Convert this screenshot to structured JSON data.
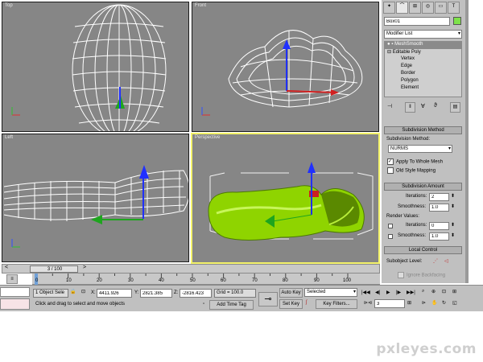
{
  "viewports": {
    "top": "Top",
    "front": "Front",
    "left": "Left",
    "perspective": "Perspective"
  },
  "command_panel": {
    "object_name": "Box01",
    "modifier_list": "Modifier List",
    "stack": [
      "MeshSmooth",
      "Editable Poly",
      "Vertex",
      "Edge",
      "Border",
      "Polygon",
      "Element"
    ],
    "subdivision_method": {
      "title": "Subdivision Method",
      "label": "Subdivision Method:",
      "value": "NURMS",
      "apply_whole_mesh": "Apply To Whole Mesh",
      "old_style": "Old Style Mapping"
    },
    "subdivision_amount": {
      "title": "Subdivision Amount",
      "iterations_label": "Iterations:",
      "iterations_value": "2",
      "smoothness_label": "Smoothness:",
      "smoothness_value": "1.0",
      "render_values": "Render Values:",
      "r_iterations_label": "Iterations:",
      "r_iterations_value": "0",
      "r_smoothness_label": "Smoothness:",
      "r_smoothness_value": "1.0"
    },
    "local_control": {
      "title": "Local Control",
      "subobject_level": "Subobject Level:",
      "ignore_backfacing": "Ignore Backfacing"
    }
  },
  "timeline": {
    "frame": "3 / 100",
    "ticks": [
      "0",
      "10",
      "20",
      "30",
      "40",
      "50",
      "60",
      "70",
      "80",
      "90",
      "100"
    ]
  },
  "status": {
    "selection": "1 Object Sele",
    "x_label": "X:",
    "x_value": "4411.926",
    "y_label": "Y:",
    "y_value": "2821.385",
    "z_label": "Z:",
    "z_value": "-2816.423",
    "grid": "Grid = 100.0",
    "prompt": "Click and drag to select and move objects",
    "add_time_tag": "Add Time Tag",
    "auto_key": "Auto Key",
    "set_key": "Set Key",
    "selected": "Selected",
    "key_filters": "Key Filters...",
    "frame_field": "3"
  },
  "watermark": "pxleyes.com",
  "colors": {
    "viewport_bg": "#868686",
    "active_border": "#f4f36a",
    "mesh_green": "#8fd400",
    "wire": "#ffffff"
  }
}
